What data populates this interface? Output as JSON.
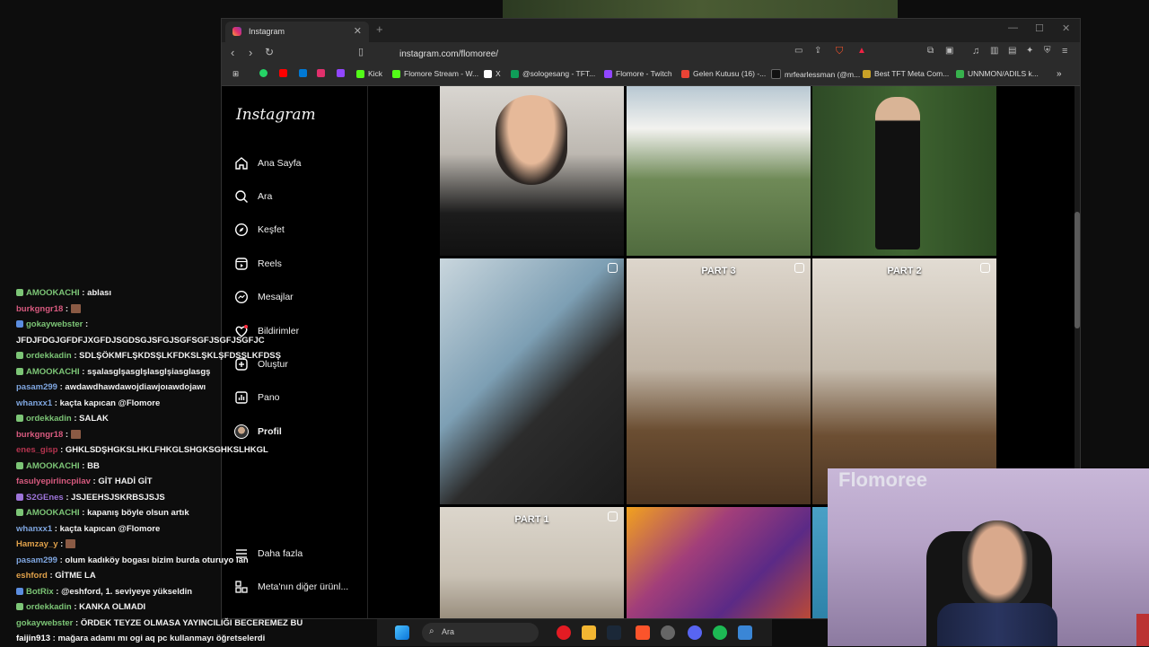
{
  "browser": {
    "tab_title": "Instagram",
    "url": "instagram.com/flomoree/",
    "bookmarks": [
      {
        "label": "",
        "color": "#25d366"
      },
      {
        "label": "",
        "color": "#ff0000"
      },
      {
        "label": "",
        "color": "#0078d4"
      },
      {
        "label": "",
        "color": "#e1306c"
      },
      {
        "label": "",
        "color": "#9146ff"
      },
      {
        "label": "Kick",
        "color": "#53fc18"
      },
      {
        "label": "Flomore Stream - W...",
        "color": "#53fc18"
      },
      {
        "label": "X",
        "color": "#ffffff"
      },
      {
        "label": "@sologesang - TFT...",
        "color": "#0f9d58"
      },
      {
        "label": "Flomore - Twitch",
        "color": "#9146ff"
      },
      {
        "label": "Gelen Kutusu (16) -...",
        "color": "#ea4335"
      },
      {
        "label": "mrfearlessman (@m...",
        "color": "#000000"
      },
      {
        "label": "Best TFT Meta Com...",
        "color": "#c9a227"
      },
      {
        "label": "UNNMON/ADILS k...",
        "color": "#37b24d"
      }
    ]
  },
  "instagram": {
    "logo": "Instagram",
    "nav": [
      {
        "label": "Ana Sayfa",
        "icon": "home-icon"
      },
      {
        "label": "Ara",
        "icon": "search-icon"
      },
      {
        "label": "Keşfet",
        "icon": "compass-icon"
      },
      {
        "label": "Reels",
        "icon": "reels-icon"
      },
      {
        "label": "Mesajlar",
        "icon": "messenger-icon"
      },
      {
        "label": "Bildirimler",
        "icon": "heart-icon"
      },
      {
        "label": "Oluştur",
        "icon": "plus-icon"
      },
      {
        "label": "Pano",
        "icon": "chart-icon"
      },
      {
        "label": "Profil",
        "icon": "avatar"
      }
    ],
    "more": "Daha fazla",
    "meta": "Meta'nın diğer ürünl...",
    "grid_labels": [
      "PART 3",
      "PART 2",
      "PART 1"
    ]
  },
  "chat": [
    {
      "user": "AMOOKACHI",
      "color": "#7cc576",
      "text": "ablası"
    },
    {
      "user": "burkgngr18",
      "color": "#d85a7f",
      "text": "",
      "emote": true
    },
    {
      "user": "gokaywebster",
      "color": "#7cc576",
      "text": ""
    },
    {
      "user": "",
      "color": "#ffffff",
      "text": "JFDJFDGJGFDFJXGFDJSGDSGJSFGJSGFSGFJSGFJSGFJC"
    },
    {
      "user": "ordekkadin",
      "color": "#7cc576",
      "text": "SDLŞÖKMFLŞKDSŞLKFDKSLŞKLŞFDSŞLKFDSŞ"
    },
    {
      "user": "AMOOKACHI",
      "color": "#7cc576",
      "text": "sşalasglşasglşlasglşiasglasgş"
    },
    {
      "user": "pasam299",
      "color": "#7fa6e0",
      "text": "awdawdhawdawojdiawjoıawdojawı"
    },
    {
      "user": "whanxx1",
      "color": "#7fa6e0",
      "text": "kaçta kapıcan @Flomore"
    },
    {
      "user": "ordekkadin",
      "color": "#7cc576",
      "text": "SALAK"
    },
    {
      "user": "burkgngr18",
      "color": "#d85a7f",
      "text": "",
      "emote": true
    },
    {
      "user": "enes_gisp",
      "color": "#b5344f",
      "text": "GHKLSDŞHGKSLHKLFHKGLSHGKSGHKSLHKGL"
    },
    {
      "user": "AMOOKACHI",
      "color": "#7cc576",
      "text": "BB"
    },
    {
      "user": "fasulyepirlincpilav",
      "color": "#d85a7f",
      "text": "GİT HADİ GİT"
    },
    {
      "user": "S2GEnes",
      "color": "#9d74d9",
      "text": "JSJEEHSJSKRBSJSJS"
    },
    {
      "user": "AMOOKACHI",
      "color": "#7cc576",
      "text": "kapanış böyle olsun artık"
    },
    {
      "user": "whanxx1",
      "color": "#7fa6e0",
      "text": "kaçta kapıcan @Flomore"
    },
    {
      "user": "Hamzay_y",
      "color": "#e0a14a",
      "text": "",
      "emote": true
    },
    {
      "user": "pasam299",
      "color": "#7fa6e0",
      "text": "olum kadıköy bogası bizim burda oturuyo lan"
    },
    {
      "user": "eshford",
      "color": "#e0a14a",
      "text": "GİTME LA"
    },
    {
      "user": "BotRix",
      "color": "#7cc576",
      "text": "@eshford, 1. seviyeye yükseldin"
    },
    {
      "user": "ordekkadin",
      "color": "#7cc576",
      "text": "KANKA OLMADI"
    },
    {
      "user": "gokaywebster",
      "color": "#7cc576",
      "text": "ÖRDEK TEYZE OLMASA YAYINCILIĞI BECEREMEZ BU"
    },
    {
      "user": "faijin913",
      "color": "#ffffff",
      "text": "mağara adamı mı ogi aq pc kullanmayı öğretselerdi"
    }
  ],
  "taskbar": {
    "search_placeholder": "Ara"
  },
  "webcam": {
    "name": "Flomoree"
  }
}
